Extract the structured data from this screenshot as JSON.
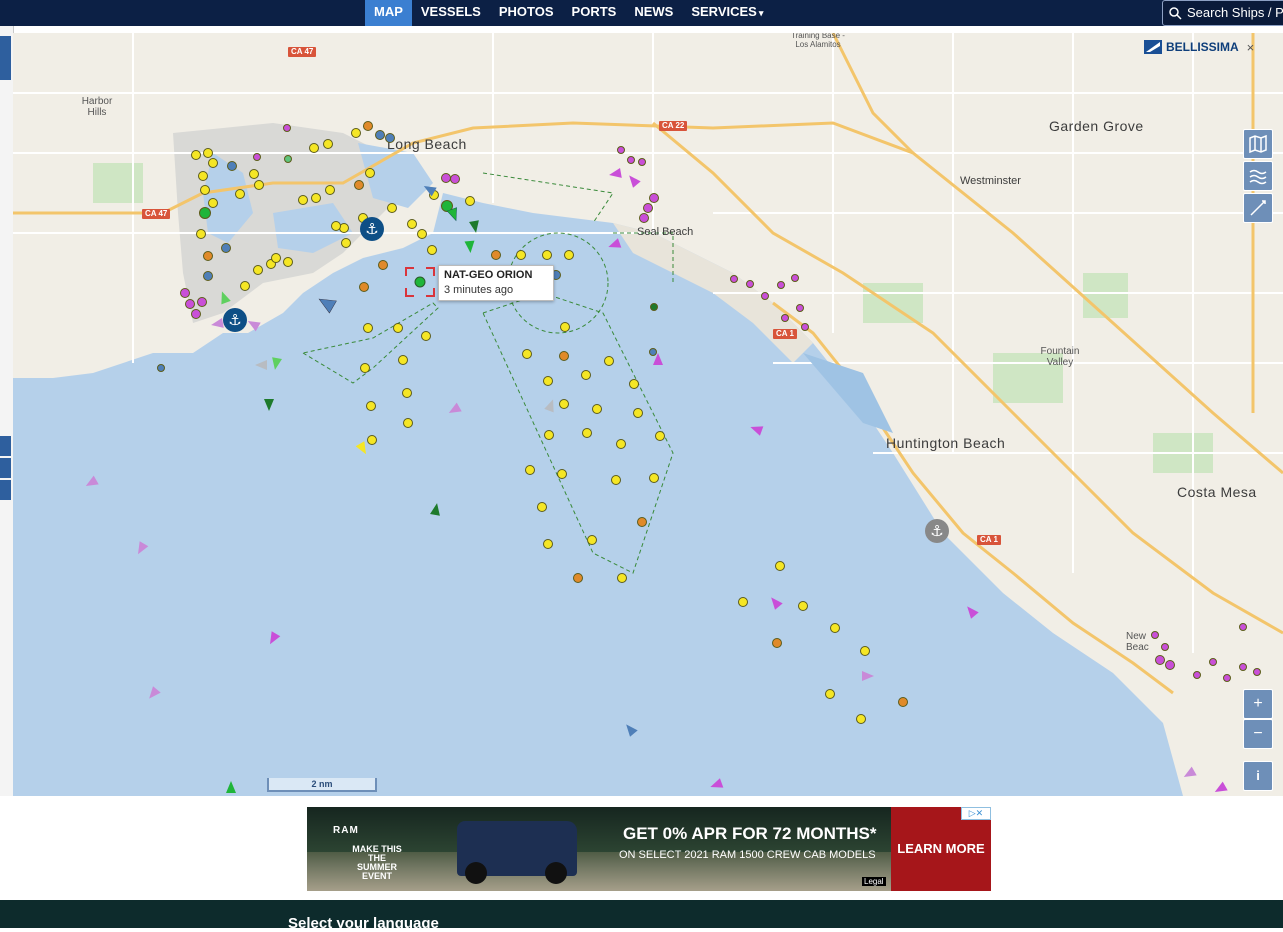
{
  "nav": {
    "items": [
      {
        "label": "MAP",
        "active": true
      },
      {
        "label": "VESSELS"
      },
      {
        "label": "PHOTOS"
      },
      {
        "label": "PORTS"
      },
      {
        "label": "NEWS"
      },
      {
        "label": "SERVICES"
      }
    ],
    "search_label": "Search Ships / P"
  },
  "map": {
    "brand_label": "BELLISSIMA",
    "close_symbol": "×",
    "places": {
      "long_beach": "Long Beach",
      "garden_grove": "Garden Grove",
      "westminster": "Westminster",
      "seal_beach": "Seal Beach",
      "fountain_valley": "Fountain Valley",
      "huntington_beach": "Huntington Beach",
      "costa_mesa": "Costa Mesa",
      "harbor_hills": "Harbor Hills",
      "newport_beach": "New Beac",
      "training_base": "Training Base - Los Alamitos"
    },
    "highways": [
      "CA 47",
      "CA 47",
      "CA 22",
      "CA 1",
      "CA 1"
    ],
    "tooltip": {
      "name": "NAT-GEO ORION",
      "time": "3 minutes ago"
    },
    "scale_label": "2 nm",
    "zoom_in": "+",
    "zoom_out": "−",
    "info": "i",
    "layer_icons": [
      "map-layers-icon",
      "weather-icon",
      "measure-icon"
    ]
  },
  "ad": {
    "brand": "RAM",
    "event_text": "MAKE THIS THE SUMMER EVENT",
    "headline": "GET 0% APR FOR 72 MONTHS*",
    "subline": "ON SELECT 2021 RAM 1500 CREW CAB MODELS",
    "cta": "LEARN MORE",
    "legal": "Legal"
  },
  "footer": {
    "language_label": "Select your language"
  },
  "colors": {
    "nav_bg": "#0c2045",
    "nav_active": "#3b7fd1",
    "water": "#b5d0ea",
    "cargo": "#f5e625",
    "tanker": "#e08a2a",
    "passenger": "#c94fd8",
    "tug": "#1fb53a",
    "ad_cta": "#a6161a"
  }
}
